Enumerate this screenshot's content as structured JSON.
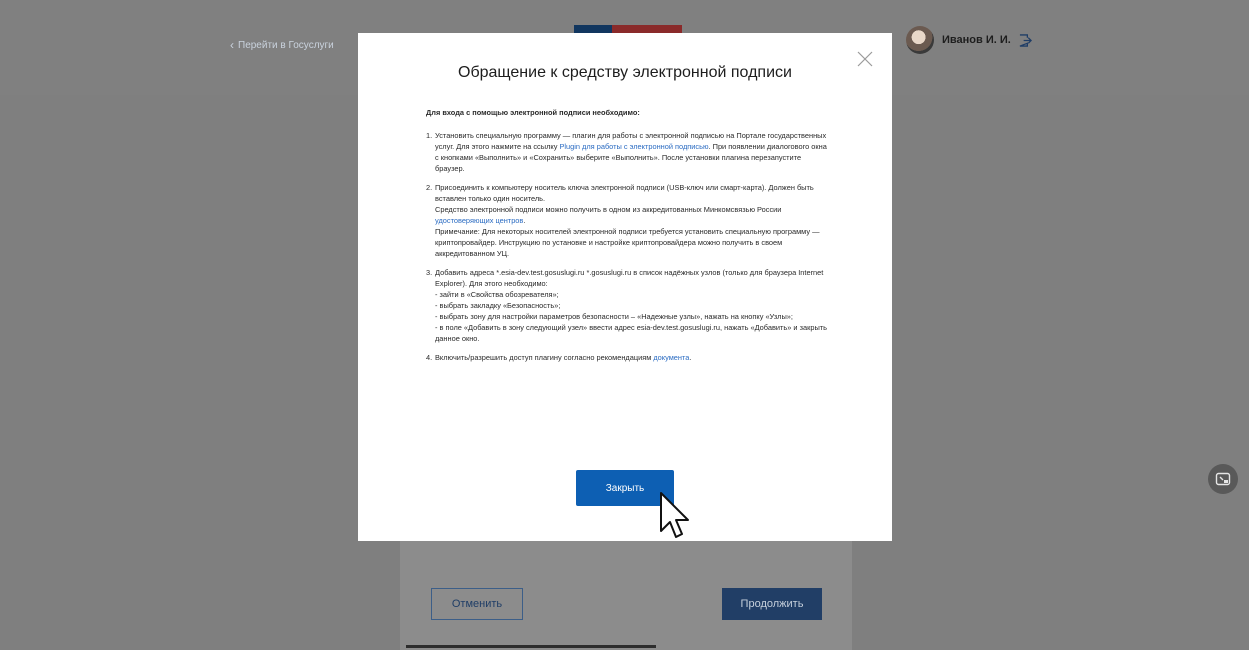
{
  "header": {
    "back_link": "Перейти в Госуслуги",
    "user_name": "Иванов И. И."
  },
  "background_form": {
    "cancel_label": "Отменить",
    "continue_label": "Продолжить"
  },
  "modal": {
    "title": "Обращение к средству электронной подписи",
    "intro": "Для входа с помощью электронной подписи необходимо:",
    "steps": [
      {
        "num": "1.",
        "p1": "Установить специальную программу — плагин для работы с электронной подписью на Портале государственных услуг. Для этого нажмите на ссылку ",
        "link": "Plugin для работы с электронной подписью",
        "p2": ". При появлении диалогового окна с кнопками «Выполнить» и «Сохранить» выберите «Выполнить». После установки плагина перезапустите браузер."
      },
      {
        "num": "2.",
        "l1": "Присоединить к компьютеру носитель ключа электронной подписи (USB-ключ или смарт-карта). Должен быть вставлен только один носитель.",
        "l2a": "Средство электронной подписи можно получить в одном из аккредитованных Минкомсвязью России ",
        "link": "удостоверяющих центров",
        "l2b": ".",
        "l3": "Примечание: Для некоторых носителей электронной подписи требуется установить специальную программу — криптопровайдер. Инструкцию по установке и настройке криптопровайдера можно получить в своем аккредитованном УЦ."
      },
      {
        "num": "3.",
        "l1": "Добавить адреса *.esia-dev.test.gosuslugi.ru *.gosuslugi.ru в список надёжных узлов (только для браузера Internet Explorer). Для этого необходимо:",
        "l2": "- зайти в «Свойства обозревателя»;",
        "l3": "- выбрать закладку «Безопасность»;",
        "l4": "- выбрать зону для настройки параметров безопасности – «Надежные узлы», нажать на кнопку «Узлы»;",
        "l5": "- в поле «Добавить в зону следующий узел» ввести адрес esia-dev.test.gosuslugi.ru, нажать «Добавить» и закрыть данное окно."
      },
      {
        "num": "4.",
        "p1": "Включить/разрешить доступ плагину согласно рекомендациям ",
        "link": "документа",
        "p2": "."
      }
    ],
    "close_button": "Закрыть"
  },
  "colors": {
    "overlay": "#7f7f7f",
    "primary_button": "#0d5fb3",
    "link": "#2a6bc2"
  },
  "icons": [
    "chevron-left-icon",
    "logout-icon",
    "close-icon",
    "screen-share-icon",
    "mouse-pointer-icon"
  ]
}
